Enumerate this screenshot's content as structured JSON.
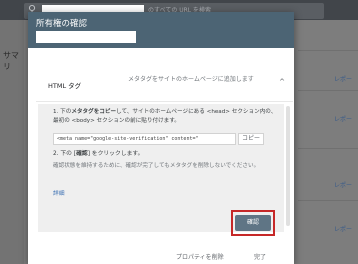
{
  "background": {
    "search_placeholder_suffix": "のすべての URL を検索",
    "sidebar_title": "サマリ",
    "report_label": "レポー"
  },
  "dialog": {
    "title": "所有権の確認",
    "method": {
      "title": "HTML タグ",
      "subtitle": "メタタグをサイトのホームページに追加します",
      "chevron": "^"
    },
    "step1": {
      "prefix": "1. 下の",
      "bold": "メタタグをコピー",
      "suffix": "して、サイトのホームページにある <head> セクション内の、最初の <body> セクションの前に貼り付けます。"
    },
    "meta_tag_value": "<meta name=\"google-site-verification\" content=\"",
    "copy_label": "コピー",
    "step2": {
      "prefix": "2. 下の [",
      "bold": "確認",
      "suffix": "] をクリックします。"
    },
    "note": "確認状態を維持するために、確認が完了してもメタタグを削除しないでください。",
    "details_link": "詳細",
    "confirm_label": "確認",
    "delete_property_label": "プロパティを削除",
    "done_label": "完了"
  },
  "colors": {
    "header": "#4c6474",
    "confirm_button": "#5f7585",
    "highlight_border": "#c62828",
    "link": "#3a6fb3"
  }
}
